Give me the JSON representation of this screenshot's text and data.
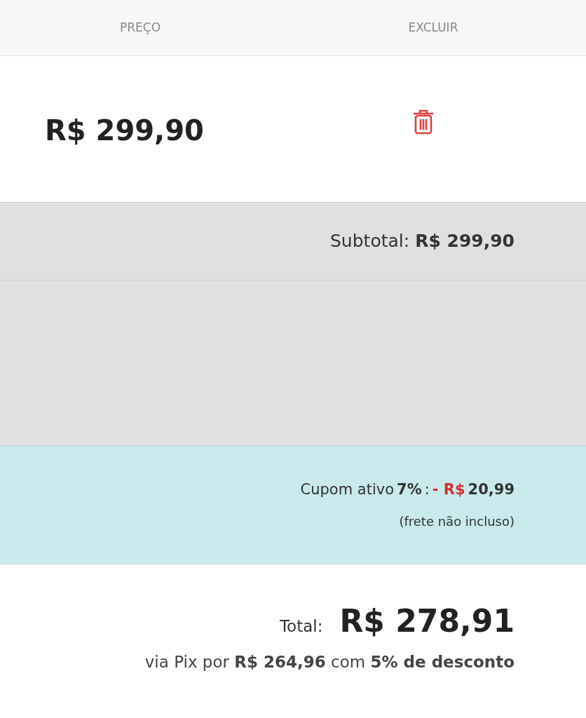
{
  "table": {
    "columns": [
      "PREÇO",
      "EXCLUIR"
    ],
    "rows": [
      {
        "price": "R$ 299,90"
      }
    ]
  },
  "subtotal": {
    "label": "Subtotal:",
    "value": "R$ 299,90"
  },
  "coupon": {
    "label": "Cupom ativo",
    "percent": "7%",
    "separator": ":",
    "discount_prefix": "- R$",
    "amount": "20,99",
    "note": "(frete não incluso)"
  },
  "total": {
    "label": "Total:",
    "value": "R$ 278,91",
    "pix": "via Pix por **R$ 264,96** com **5% de desconto**"
  }
}
